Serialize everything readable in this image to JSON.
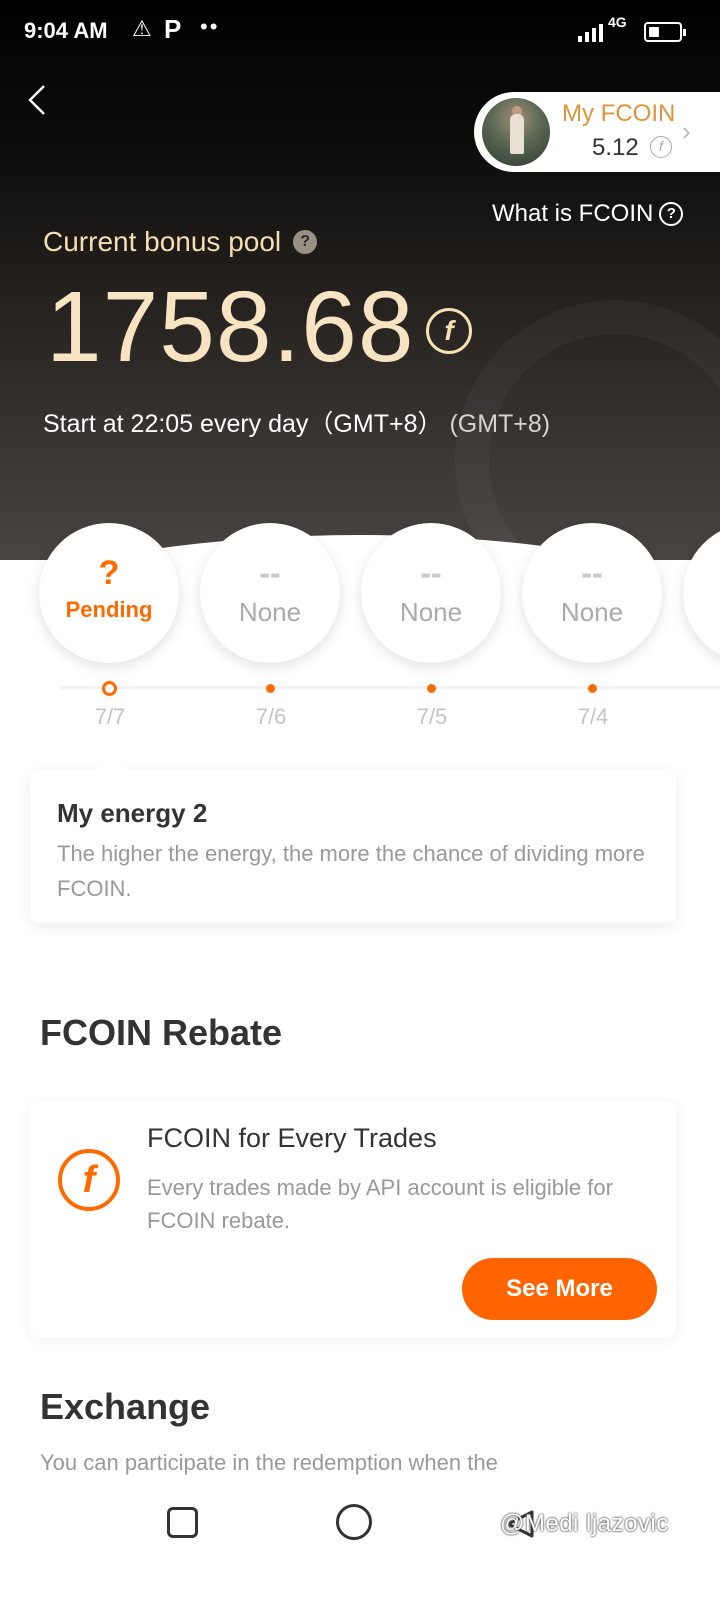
{
  "status_bar": {
    "time": "9:04 AM",
    "network": "4G",
    "icons": [
      "warning-icon",
      "parking-icon",
      "dots-icon",
      "signal-icon",
      "battery-icon"
    ]
  },
  "header": {
    "back_icon": "back-chevron-icon",
    "my_fcoin": {
      "label": "My FCOIN",
      "balance": "5.12",
      "coin_glyph": "f"
    },
    "what_is_fcoin": "What is FCOIN",
    "help_glyph": "?"
  },
  "bonus_pool": {
    "label": "Current bonus pool",
    "help_glyph": "?",
    "amount": "1758.68",
    "coin_glyph": "f",
    "start_text": "Start at 22:05 every day（GMT+8）",
    "start_extra": "(GMT+8)"
  },
  "days": [
    {
      "top": "?",
      "label": "Pending",
      "date": "7/7",
      "active": true
    },
    {
      "top": "--",
      "label": "None",
      "date": "7/6",
      "active": false
    },
    {
      "top": "--",
      "label": "None",
      "date": "7/5",
      "active": false
    },
    {
      "top": "--",
      "label": "None",
      "date": "7/4",
      "active": false
    }
  ],
  "energy": {
    "title": "My energy 2",
    "description": "The higher the energy, the more the chance of dividing more FCOIN."
  },
  "rebate": {
    "section_title": "FCOIN Rebate",
    "card_title": "FCOIN for Every Trades",
    "card_desc": "Every trades made by API account is eligible for FCOIN rebate.",
    "button": "See More",
    "icon_glyph": "f"
  },
  "exchange": {
    "section_title": "Exchange",
    "description": "You can participate in the redemption when the"
  },
  "watermark": "@Medi ljazovic",
  "colors": {
    "accent": "#ff6400",
    "gold": "#f5dfb3",
    "pill_label": "#e0933a"
  }
}
